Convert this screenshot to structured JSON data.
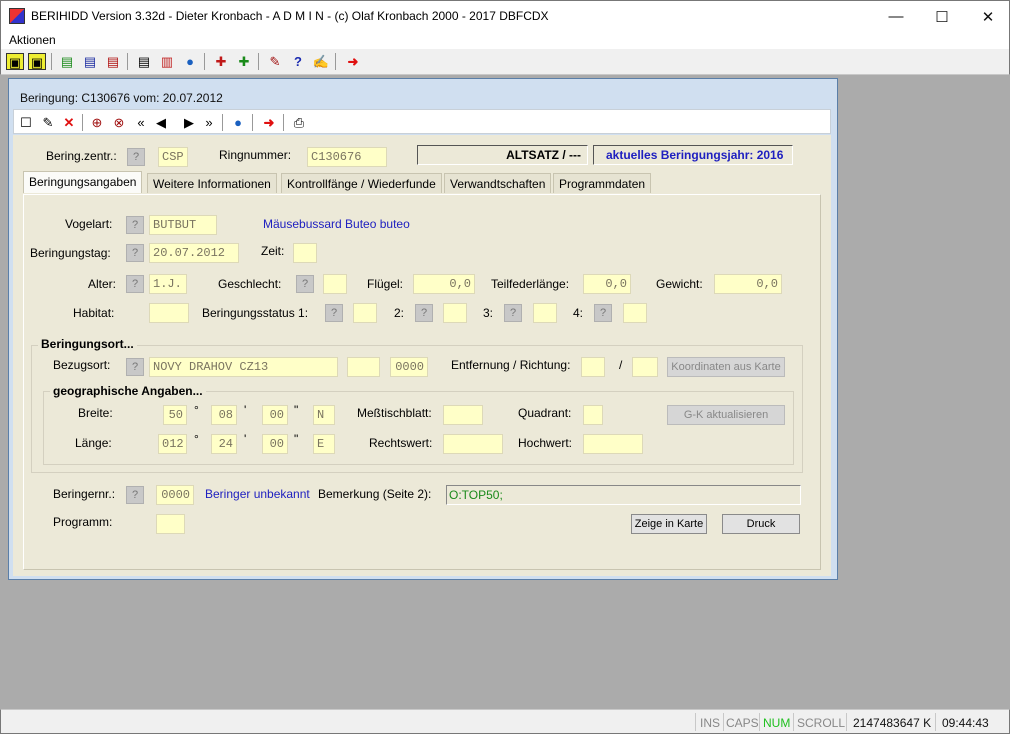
{
  "window": {
    "title": "BERIHIDD Version 3.32d - Dieter Kronbach - A D M I N - (c) Olaf Kronbach 2000 - 2017  DBFCDX",
    "min": "—",
    "max": "☐",
    "close": "✕"
  },
  "menu": {
    "aktionen": "Aktionen"
  },
  "child": {
    "title": "Beringung: C130676    vom: 20.07.2012"
  },
  "header": {
    "beringzentr_label": "Bering.zentr.:",
    "beringzentr_value": "CSP",
    "ringnummer_label": "Ringnummer:",
    "ringnummer_value": "C130676",
    "altsatz": "ALTSATZ / ---",
    "beringungsjahr": "aktuelles Beringungsjahr: 2016"
  },
  "tabs": [
    "Beringungsangaben",
    "Weitere Informationen",
    "Kontrollfänge / Wiederfunde",
    "Verwandtschaften",
    "Programmdaten"
  ],
  "form": {
    "vogelart_label": "Vogelart:",
    "vogelart_value": "BUTBUT",
    "vogelart_name": "Mäusebussard Buteo buteo",
    "beringungstag_label": "Beringungstag:",
    "beringungstag_value": "20.07.2012",
    "zeit_label": "Zeit:",
    "zeit_value": "",
    "alter_label": "Alter:",
    "alter_value": "1.J.",
    "geschlecht_label": "Geschlecht:",
    "geschlecht_value": "",
    "fluegel_label": "Flügel:",
    "fluegel_value": "0,0",
    "teilfeder_label": "Teilfederlänge:",
    "teilfeder_value": "0,0",
    "gewicht_label": "Gewicht:",
    "gewicht_value": "0,0",
    "habitat_label": "Habitat:",
    "habitat_value": "",
    "status1_label": "Beringungsstatus 1:",
    "status2_label": "2:",
    "status3_label": "3:",
    "status4_label": "4:",
    "beringungsort_title": "Beringungsort...",
    "bezugsort_label": "Bezugsort:",
    "bezugsort_value": "NOVY DRAHOV CZ13",
    "bezugsort_code": "",
    "bezugsort_num": "0000",
    "entfernung_label": "Entfernung / Richtung:",
    "slash": "/",
    "koordinaten_button": "Koordinaten aus Karte",
    "geo_title": "geographische Angaben...",
    "breite_label": "Breite:",
    "breite_deg": "50",
    "breite_min": "08",
    "breite_sec": "00",
    "breite_dir": "N",
    "laenge_label": "Länge:",
    "laenge_deg": "012",
    "laenge_min": "24",
    "laenge_sec": "00",
    "laenge_dir": "E",
    "deg_sym": "°",
    "min_sym": "'",
    "sec_sym": "\"",
    "messtisch_label": "Meßtischblatt:",
    "quadrant_label": "Quadrant:",
    "gk_button": "G-K aktualisieren",
    "rechtswert_label": "Rechtswert:",
    "hochwert_label": "Hochwert:",
    "beringernr_label": "Beringernr.:",
    "beringernr_value": "0000",
    "beringer_name": "Beringer unbekannt",
    "bemerkung_label": "Bemerkung (Seite 2):",
    "bemerkung_value": "O:TOP50;",
    "programm_label": "Programm:",
    "programm_value": "",
    "zeige_button": "Zeige in Karte",
    "druck_button": "Druck",
    "q": "?"
  },
  "status": {
    "ins": "INS",
    "caps": "CAPS",
    "num": "NUM",
    "scroll": "SCROLL",
    "mem": "2147483647 K",
    "time": "09:44:43"
  },
  "colors": {
    "field": "#ffffc8",
    "panel": "#ece9d8",
    "accent_blue": "#1f20c0",
    "num_active": "#20c020"
  }
}
